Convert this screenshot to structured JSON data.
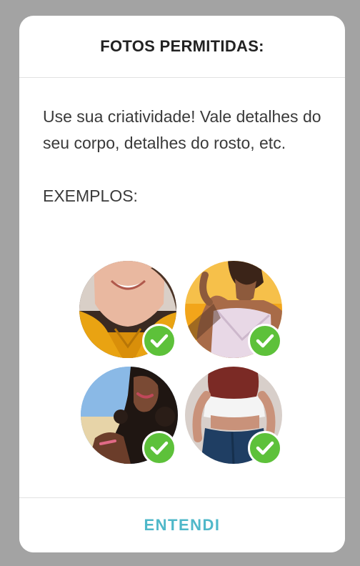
{
  "modal": {
    "title": "FOTOS PERMITIDAS:",
    "description": "Use sua criatividade! Vale detalhes do seu corpo, detalhes do rosto, etc.",
    "examples_label": "EXEMPLOS:",
    "examples": [
      {
        "icon": "check-icon",
        "status": "allowed"
      },
      {
        "icon": "check-icon",
        "status": "allowed"
      },
      {
        "icon": "check-icon",
        "status": "allowed"
      },
      {
        "icon": "check-icon",
        "status": "allowed"
      }
    ],
    "confirm_label": "ENTENDI"
  },
  "colors": {
    "backdrop": "#a3a3a3",
    "check": "#5dc13a",
    "accent": "#4fb8c9"
  }
}
